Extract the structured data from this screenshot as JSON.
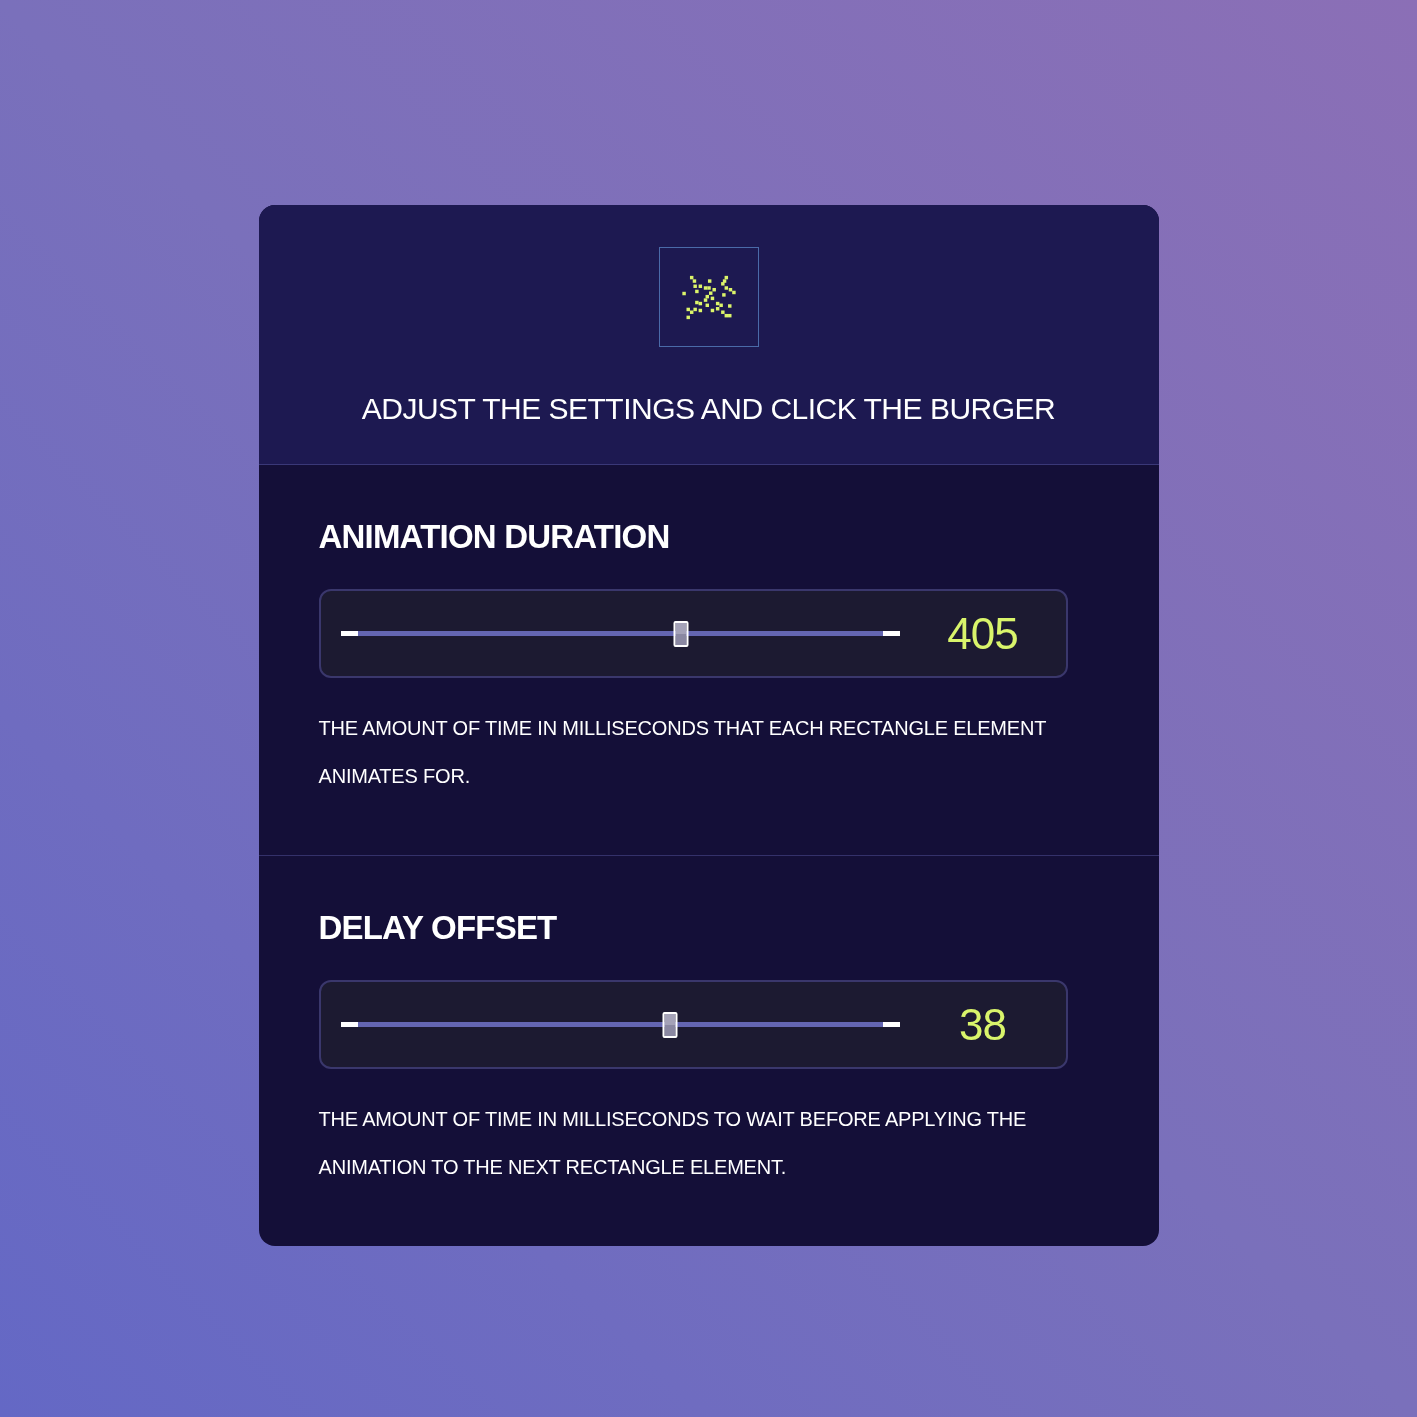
{
  "header": {
    "title": "ADJUST THE SETTINGS AND CLICK THE BURGER"
  },
  "settings": [
    {
      "label": "ANIMATION DURATION",
      "level": 0.61,
      "value": "405",
      "description": "THE AMOUNT OF TIME IN MILLISECONDS THAT EACH RECTANGLE ELEMENT ANIMATES FOR."
    },
    {
      "label": "DELAY OFFSET",
      "level": 0.59,
      "value": "38",
      "description": "THE AMOUNT OF TIME IN MILLISECONDS TO WAIT BEFORE APPLYING THE ANIMATION TO THE NEXT RECTANGLE ELEMENT."
    }
  ]
}
